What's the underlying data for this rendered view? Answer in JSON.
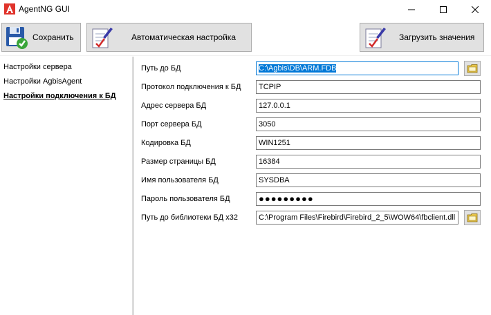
{
  "window": {
    "title": "AgentNG GUI"
  },
  "toolbar": {
    "save_label": "Сохранить",
    "auto_label": "Автоматическая настройка",
    "load_label": "Загрузить значения"
  },
  "sidebar": {
    "items": [
      {
        "label": "Настройки сервера",
        "active": false
      },
      {
        "label": "Настройки AgbisAgent",
        "active": false
      },
      {
        "label": "Настройки подключения к БД",
        "active": true
      }
    ]
  },
  "form": {
    "fields": [
      {
        "label": "Путь до БД",
        "value": "C:\\Agbis\\DB\\ARM.FDB",
        "has_browse": true
      },
      {
        "label": "Протокол подключения к БД",
        "value": "TCPIP"
      },
      {
        "label": "Адрес сервера БД",
        "value": "127.0.0.1"
      },
      {
        "label": "Порт сервера БД",
        "value": "3050"
      },
      {
        "label": "Кодировка БД",
        "value": "WIN1251"
      },
      {
        "label": "Размер страницы БД",
        "value": "16384"
      },
      {
        "label": "Имя пользователя БД",
        "value": "SYSDBA"
      },
      {
        "label": "Пароль пользователя БД",
        "value": "●●●●●●●●●"
      },
      {
        "label": "Путь до библиотеки БД x32",
        "value": "C:\\Program Files\\Firebird\\Firebird_2_5\\WOW64\\fbclient.dll",
        "has_browse": true
      }
    ]
  },
  "colors": {
    "accent": "#0078d7",
    "button_face": "#e1e1e1",
    "logo_red": "#e0332b"
  },
  "icons": {
    "app": "agent-logo-icon",
    "save": "floppy-check-icon",
    "auto": "pen-checklist-icon",
    "load": "pen-checklist-icon",
    "browse": "folder-icon"
  }
}
